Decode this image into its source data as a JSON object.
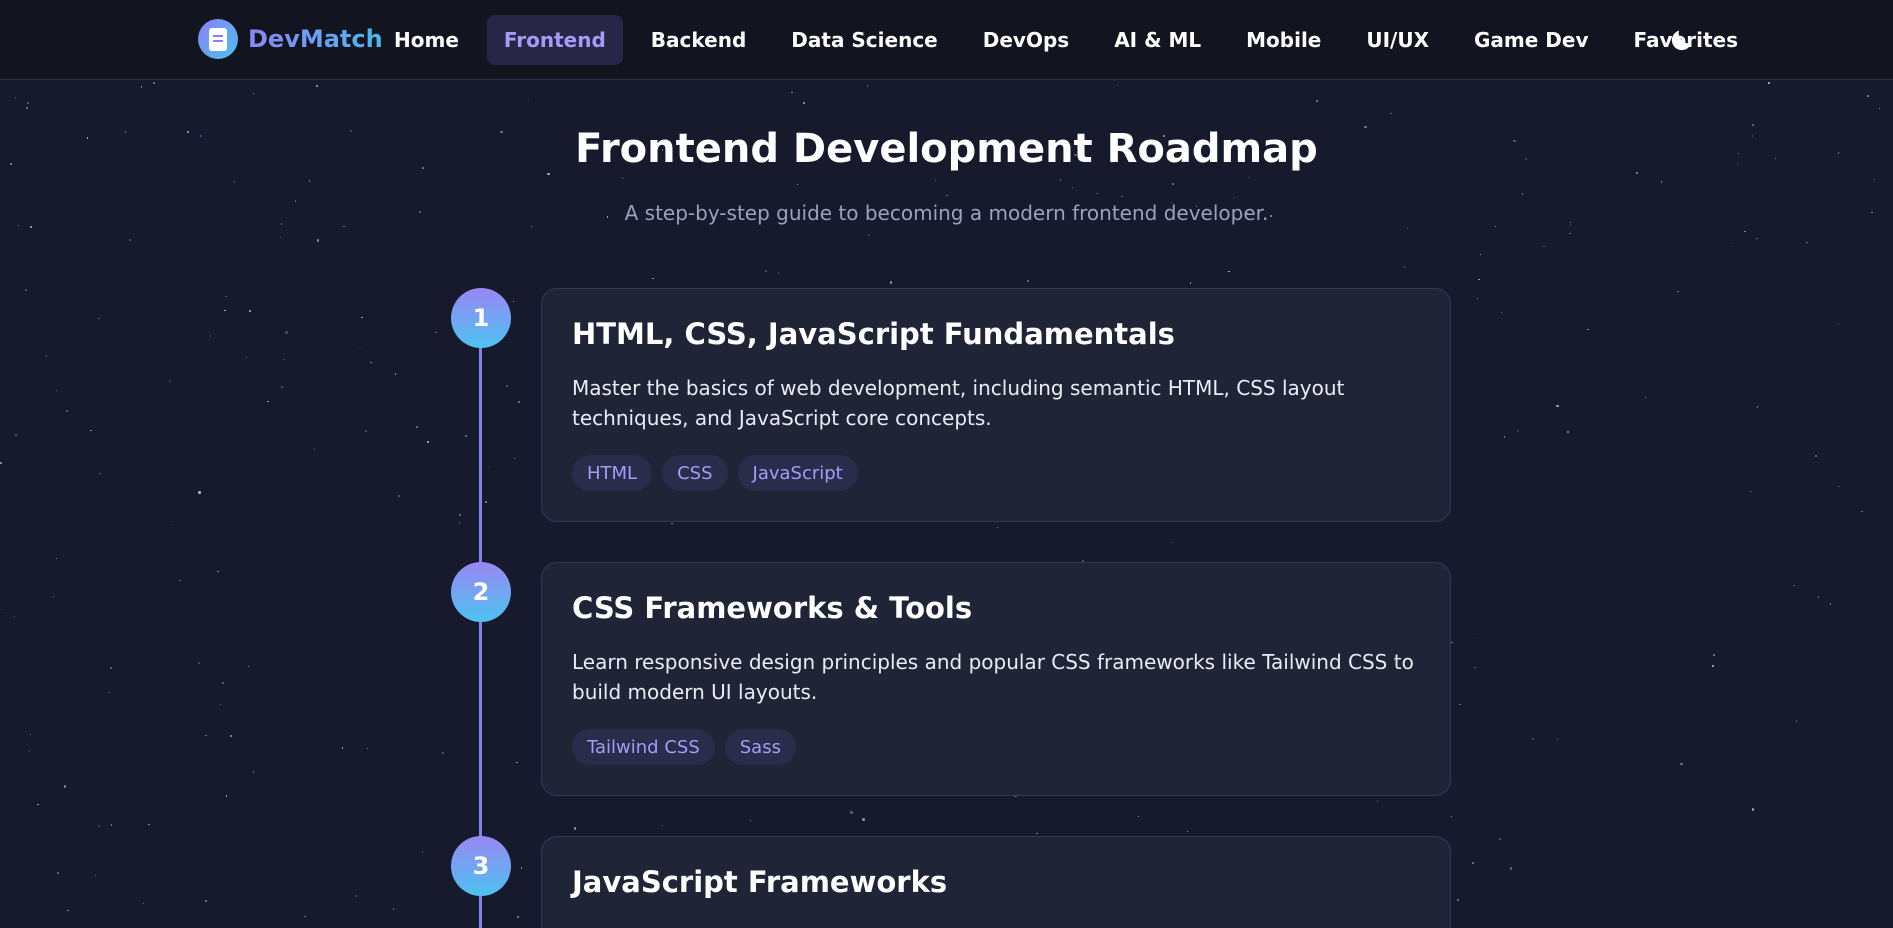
{
  "brand": {
    "name": "DevMatch",
    "logo_icon": "book-icon"
  },
  "nav": {
    "items": [
      {
        "label": "Home",
        "active": false
      },
      {
        "label": "Frontend",
        "active": true
      },
      {
        "label": "Backend",
        "active": false
      },
      {
        "label": "Data Science",
        "active": false
      },
      {
        "label": "DevOps",
        "active": false
      },
      {
        "label": "AI & ML",
        "active": false
      },
      {
        "label": "Mobile",
        "active": false
      },
      {
        "label": "UI/UX",
        "active": false
      },
      {
        "label": "Game Dev",
        "active": false
      },
      {
        "label": "Favorites",
        "active": false
      }
    ],
    "theme_toggle_icon": "moon-icon"
  },
  "header": {
    "title": "Frontend Development Roadmap",
    "subtitle": "A step-by-step guide to becoming a modern frontend developer."
  },
  "steps": [
    {
      "number": "1",
      "title": "HTML, CSS, JavaScript Fundamentals",
      "description": "Master the basics of web development, including semantic HTML, CSS layout techniques, and JavaScript core concepts.",
      "tags": [
        "HTML",
        "CSS",
        "JavaScript"
      ]
    },
    {
      "number": "2",
      "title": "CSS Frameworks & Tools",
      "description": "Learn responsive design principles and popular CSS frameworks like Tailwind CSS to build modern UI layouts.",
      "tags": [
        "Tailwind CSS",
        "Sass"
      ]
    },
    {
      "number": "3",
      "title": "JavaScript Frameworks"
    }
  ],
  "colors": {
    "background": "#161a2c",
    "nav_background": "#12151f",
    "card_background": "#1f2536",
    "accent_purple": "#a69cf7",
    "accent_blue": "#4cc3f0",
    "timeline": "#7f85e8"
  }
}
